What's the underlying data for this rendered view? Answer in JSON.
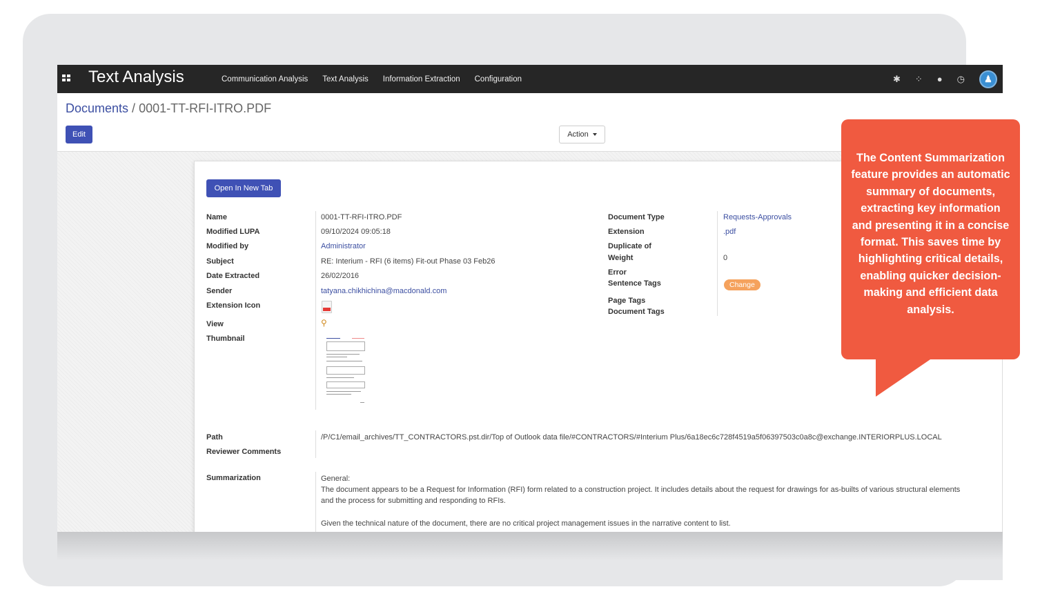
{
  "navbar": {
    "app_title": "Text Analysis",
    "menu": [
      "Communication Analysis",
      "Text Analysis",
      "Information Extraction",
      "Configuration"
    ],
    "icons": [
      "bug-icon",
      "spinner-icon",
      "chat-icon",
      "clock-icon",
      "avatar"
    ]
  },
  "breadcrumb": {
    "parent": "Documents",
    "separator": " / ",
    "current": "0001-TT-RFI-ITRO.PDF"
  },
  "buttons": {
    "edit": "Edit",
    "action": "Action",
    "open_new_tab": "Open In New Tab",
    "change": "Change"
  },
  "fields_left": {
    "name_label": "Name",
    "name_value": "0001-TT-RFI-ITRO.PDF",
    "modified_lupa_label": "Modified LUPA",
    "modified_lupa_value": "09/10/2024 09:05:18",
    "modified_by_label": "Modified by",
    "modified_by_value": "Administrator",
    "subject_label": "Subject",
    "subject_value": "RE: Interium - RFI (6 items) Fit-out Phase 03 Feb26",
    "date_extracted_label": "Date Extracted",
    "date_extracted_value": "26/02/2016",
    "sender_label": "Sender",
    "sender_value": "tatyana.chikhichina@macdonald.com",
    "extension_icon_label": "Extension Icon",
    "view_label": "View",
    "thumbnail_label": "Thumbnail"
  },
  "fields_right": {
    "document_type_label": "Document Type",
    "document_type_value": "Requests-Approvals",
    "extension_label": "Extension",
    "extension_value": ".pdf",
    "duplicate_of_label": "Duplicate of",
    "weight_label": "Weight",
    "weight_value": "0",
    "error_label": "Error",
    "sentence_tags_label": "Sentence Tags",
    "page_tags_label": "Page Tags",
    "document_tags_label": "Document Tags"
  },
  "path": {
    "label": "Path",
    "value": "/P/C1/email_archives/TT_CONTRACTORS.pst.dir/Top of Outlook data file/#CONTRACTORS/#Interium Plus/6a18ec6c728f4519a5f06397503c0a8c@exchange.INTERIORPLUS.LOCAL"
  },
  "reviewer_comments": {
    "label": "Reviewer Comments"
  },
  "summarization": {
    "label": "Summarization",
    "heading": "General:",
    "para1": "The document appears to be a Request for Information (RFI) form related to a construction project. It includes details about the request for drawings for as-builts of various structural elements and the process for submitting and responding to RFIs.",
    "para2": "Given the technical nature of the document, there are no critical project management issues in the narrative content to list."
  },
  "callout": {
    "text": "The Content Summarization feature provides an automatic summary of documents, extracting key information and presenting it in a concise format. This saves time by highlighting critical details, enabling quicker decision-making and efficient data analysis.",
    "color": "#f05a40"
  },
  "colors": {
    "navbar": "#262626",
    "primary": "#3f51b5",
    "link": "#3b4ea1",
    "badge": "#f5a25d"
  }
}
